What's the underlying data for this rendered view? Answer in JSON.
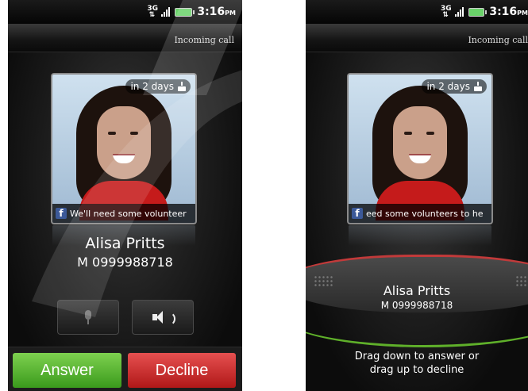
{
  "status_bar": {
    "network": "3G",
    "time": "3:16",
    "ampm": "PM"
  },
  "header": {
    "label": "Incoming call"
  },
  "contact": {
    "name": "Alisa Pritts",
    "number": "M 0999988718",
    "birthday_badge": "in 2 days"
  },
  "screens": {
    "left": {
      "facebook_status": "We'll need some volunteer"
    },
    "right": {
      "facebook_status": "eed some volunteers to he"
    }
  },
  "actions": {
    "answer": "Answer",
    "decline": "Decline"
  },
  "lock_hint": {
    "line1": "Drag down to answer or",
    "line2": "drag up to decline"
  }
}
